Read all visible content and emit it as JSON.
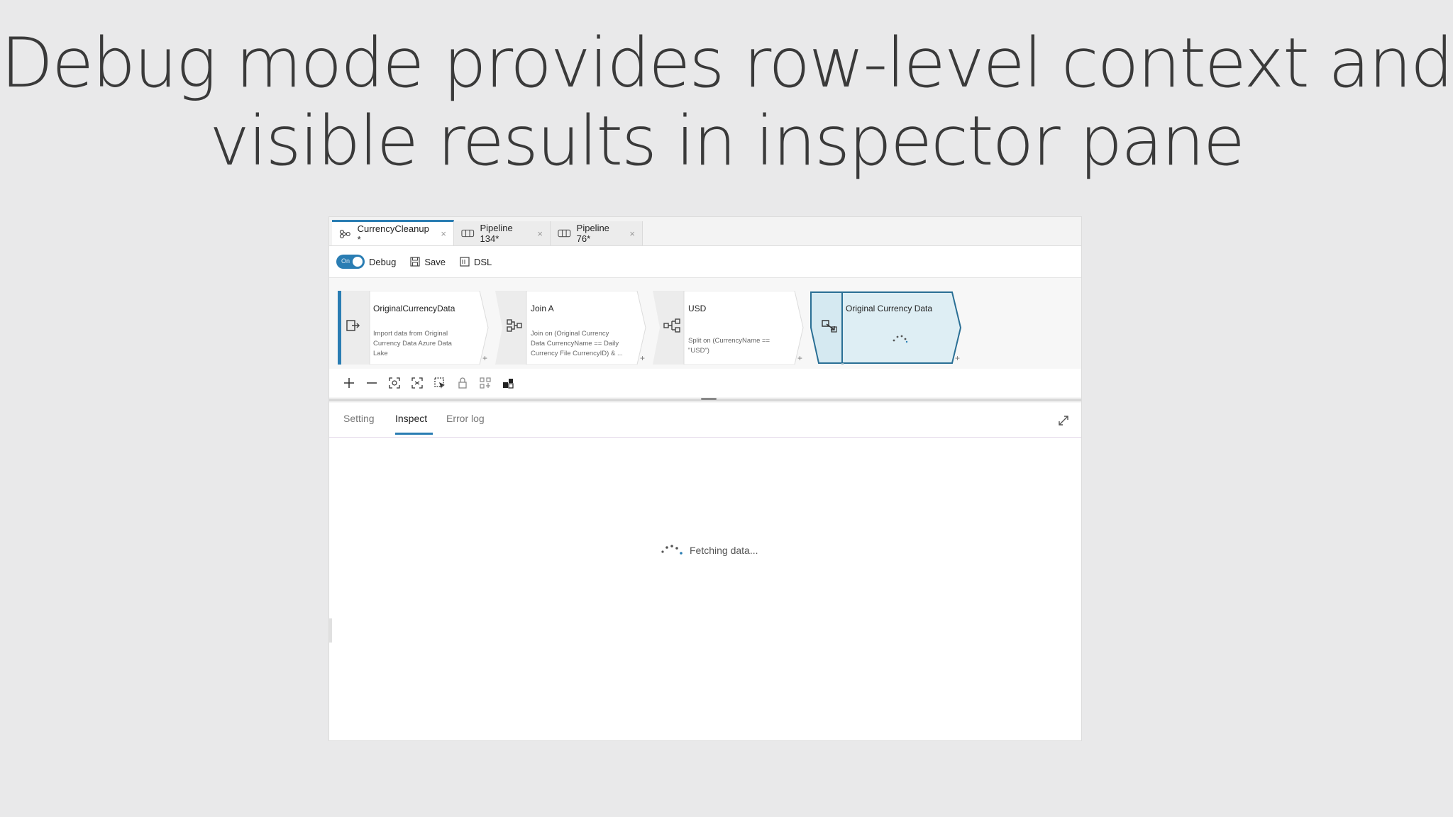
{
  "slide": {
    "title_line1": "Debug mode provides row-level context and",
    "title_line2": "visible results in inspector pane"
  },
  "tabs": [
    {
      "label": "CurrencyCleanup *",
      "icon": "dataflow-icon",
      "active": true
    },
    {
      "label": "Pipeline 134*",
      "icon": "pipeline-icon",
      "active": false
    },
    {
      "label": "Pipeline 76*",
      "icon": "pipeline-icon",
      "active": false
    }
  ],
  "tab_close": "×",
  "toolbar": {
    "debug_toggle_state": "On",
    "debug_label": "Debug",
    "save_label": "Save",
    "dsl_label": "DSL"
  },
  "nodes": [
    {
      "title": "OriginalCurrencyData",
      "desc": "Import data from Original Currency Data Azure Data Lake",
      "icon": "source-icon"
    },
    {
      "title": "Join A",
      "desc": "Join on (Original Currency Data CurrencyName == Daily Currency File CurrencyID) & ...",
      "icon": "join-icon"
    },
    {
      "title": "USD",
      "desc": "Split on (CurrencyName == \"USD\")",
      "icon": "split-icon"
    },
    {
      "title": "Original Currency Data",
      "desc": "",
      "icon": "sink-icon"
    }
  ],
  "add_symbol": "+",
  "canvas_tools": [
    "zoom-in-icon",
    "zoom-out-icon",
    "zoom-fit-icon",
    "zoom-reset-icon",
    "select-icon",
    "lock-icon",
    "auto-align-icon",
    "minimap-icon"
  ],
  "panel": {
    "tabs": [
      "Setting",
      "Inspect",
      "Error log"
    ],
    "active_tab": "Inspect",
    "loading_text": "Fetching data..."
  },
  "colors": {
    "accent": "#2a7db3",
    "selected_node_fill": "#deeef4",
    "selected_node_stroke": "#2a6f95"
  }
}
